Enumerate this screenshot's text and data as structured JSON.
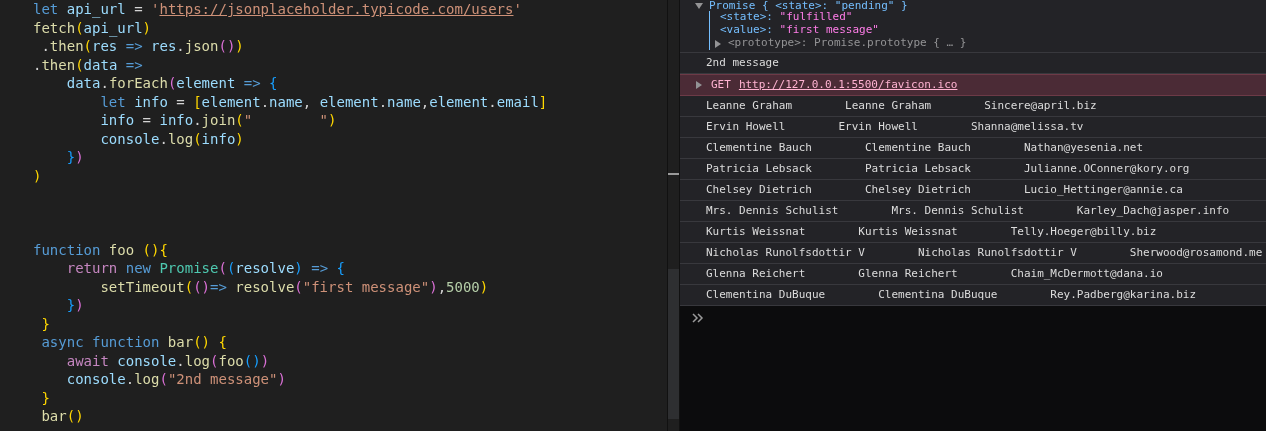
{
  "editor": {
    "blocks": [
      {
        "lines": [
          [
            {
              "kind": "kw",
              "t": "let"
            },
            {
              "kind": "var",
              "t": " api_url"
            },
            {
              "kind": "p",
              "t": " = "
            },
            {
              "kind": "str",
              "t": "'"
            },
            {
              "kind": "link",
              "t": "https://jsonplaceholder.typicode.com/users"
            },
            {
              "kind": "str",
              "t": "'"
            }
          ],
          [
            {
              "kind": "fn",
              "t": "fetch"
            },
            {
              "kind": "b1",
              "t": "("
            },
            {
              "kind": "var",
              "t": "api_url"
            },
            {
              "kind": "b1",
              "t": ")"
            }
          ],
          [
            {
              "kind": "p",
              "t": " ."
            },
            {
              "kind": "fn",
              "t": "then"
            },
            {
              "kind": "b1",
              "t": "("
            },
            {
              "kind": "var",
              "t": "res"
            },
            {
              "kind": "kw",
              "t": " =>"
            },
            {
              "kind": "var",
              "t": " res"
            },
            {
              "kind": "p",
              "t": "."
            },
            {
              "kind": "fn",
              "t": "json"
            },
            {
              "kind": "b2",
              "t": "()"
            },
            {
              "kind": "b1",
              "t": ")"
            }
          ],
          [
            {
              "kind": "p",
              "t": "."
            },
            {
              "kind": "fn",
              "t": "then"
            },
            {
              "kind": "b1",
              "t": "("
            },
            {
              "kind": "var",
              "t": "data"
            },
            {
              "kind": "kw",
              "t": " =>"
            }
          ],
          [
            {
              "kind": "var",
              "t": "    data"
            },
            {
              "kind": "p",
              "t": "."
            },
            {
              "kind": "fn",
              "t": "forEach"
            },
            {
              "kind": "b2",
              "t": "("
            },
            {
              "kind": "var",
              "t": "element"
            },
            {
              "kind": "kw",
              "t": " =>"
            },
            {
              "kind": "b3",
              "t": " {"
            }
          ],
          [
            {
              "kind": "kw",
              "t": "        let"
            },
            {
              "kind": "var",
              "t": " info"
            },
            {
              "kind": "p",
              "t": " = "
            },
            {
              "kind": "b1",
              "t": "["
            },
            {
              "kind": "var",
              "t": "element"
            },
            {
              "kind": "p",
              "t": "."
            },
            {
              "kind": "var",
              "t": "name"
            },
            {
              "kind": "p",
              "t": ", "
            },
            {
              "kind": "var",
              "t": "element"
            },
            {
              "kind": "p",
              "t": "."
            },
            {
              "kind": "var",
              "t": "name"
            },
            {
              "kind": "p",
              "t": ","
            },
            {
              "kind": "var",
              "t": "element"
            },
            {
              "kind": "p",
              "t": "."
            },
            {
              "kind": "var",
              "t": "email"
            },
            {
              "kind": "b1",
              "t": "]"
            }
          ],
          [
            {
              "kind": "var",
              "t": "        info"
            },
            {
              "kind": "p",
              "t": " = "
            },
            {
              "kind": "var",
              "t": "info"
            },
            {
              "kind": "p",
              "t": "."
            },
            {
              "kind": "fn",
              "t": "join"
            },
            {
              "kind": "b1",
              "t": "("
            },
            {
              "kind": "str",
              "t": "\"        \""
            },
            {
              "kind": "b1",
              "t": ")"
            }
          ],
          [
            {
              "kind": "var",
              "t": "        console"
            },
            {
              "kind": "p",
              "t": "."
            },
            {
              "kind": "fn",
              "t": "log"
            },
            {
              "kind": "b1",
              "t": "("
            },
            {
              "kind": "var",
              "t": "info"
            },
            {
              "kind": "b1",
              "t": ")"
            }
          ],
          [
            {
              "kind": "b3",
              "t": "    }"
            },
            {
              "kind": "b2",
              "t": ")"
            }
          ],
          [
            {
              "kind": "b1",
              "t": ")"
            }
          ]
        ]
      },
      {
        "lines": [
          [
            {
              "kind": "kw",
              "t": "function"
            },
            {
              "kind": "fn",
              "t": " foo"
            },
            {
              "kind": "b1",
              "t": " (){"
            }
          ],
          [
            {
              "kind": "ctrl",
              "t": "    return"
            },
            {
              "kind": "kw",
              "t": " new"
            },
            {
              "kind": "cls",
              "t": " Promise"
            },
            {
              "kind": "b2",
              "t": "("
            },
            {
              "kind": "b3",
              "t": "("
            },
            {
              "kind": "var",
              "t": "resolve"
            },
            {
              "kind": "b3",
              "t": ")"
            },
            {
              "kind": "kw",
              "t": " =>"
            },
            {
              "kind": "b3",
              "t": " {"
            }
          ],
          [
            {
              "kind": "fn",
              "t": "        setTimeout"
            },
            {
              "kind": "b1",
              "t": "("
            },
            {
              "kind": "b2",
              "t": "()"
            },
            {
              "kind": "kw",
              "t": "=>"
            },
            {
              "kind": "fn",
              "t": " resolve"
            },
            {
              "kind": "b2",
              "t": "("
            },
            {
              "kind": "str",
              "t": "\"first message\""
            },
            {
              "kind": "b2",
              "t": ")"
            },
            {
              "kind": "p",
              "t": ","
            },
            {
              "kind": "num",
              "t": "5000"
            },
            {
              "kind": "b1",
              "t": ")"
            }
          ],
          [
            {
              "kind": "b3",
              "t": "    }"
            },
            {
              "kind": "b2",
              "t": ")"
            }
          ],
          [
            {
              "kind": "b1",
              "t": " }"
            }
          ],
          [
            {
              "kind": "kw",
              "t": " async"
            },
            {
              "kind": "kw",
              "t": " function"
            },
            {
              "kind": "fn",
              "t": " bar"
            },
            {
              "kind": "b1",
              "t": "()"
            },
            {
              "kind": "b1",
              "t": " {"
            }
          ],
          [
            {
              "kind": "ctrl",
              "t": "    await"
            },
            {
              "kind": "var",
              "t": " console"
            },
            {
              "kind": "p",
              "t": "."
            },
            {
              "kind": "fn",
              "t": "log"
            },
            {
              "kind": "b2",
              "t": "("
            },
            {
              "kind": "fn",
              "t": "foo"
            },
            {
              "kind": "b3",
              "t": "()"
            },
            {
              "kind": "b2",
              "t": ")"
            }
          ],
          [
            {
              "kind": "var",
              "t": "    console"
            },
            {
              "kind": "p",
              "t": "."
            },
            {
              "kind": "fn",
              "t": "log"
            },
            {
              "kind": "b2",
              "t": "("
            },
            {
              "kind": "str",
              "t": "\"2nd message\""
            },
            {
              "kind": "b2",
              "t": ")"
            }
          ],
          [
            {
              "kind": "b1",
              "t": " }"
            }
          ],
          [
            {
              "kind": "fn",
              "t": " bar"
            },
            {
              "kind": "b1",
              "t": "()"
            }
          ]
        ]
      }
    ]
  },
  "console": {
    "promise": {
      "label": "Promise { <state>: \"pending\" }",
      "expanded": true,
      "props": [
        {
          "key": "<state>:",
          "value": "\"fulfilled\""
        },
        {
          "key": "<value>:",
          "value": "\"first message\""
        }
      ],
      "prototype": {
        "key": "<prototype>:",
        "value": "Promise.prototype { … }",
        "expanded": false
      }
    },
    "messages": [
      {
        "kind": "log",
        "text": "2nd message"
      },
      {
        "kind": "error",
        "method": "GET",
        "url": "http://127.0.0.1:5500/favicon.ico",
        "expanded": false
      },
      {
        "kind": "log",
        "text": "Leanne Graham        Leanne Graham        Sincere@april.biz"
      },
      {
        "kind": "log",
        "text": "Ervin Howell        Ervin Howell        Shanna@melissa.tv"
      },
      {
        "kind": "log",
        "text": "Clementine Bauch        Clementine Bauch        Nathan@yesenia.net"
      },
      {
        "kind": "log",
        "text": "Patricia Lebsack        Patricia Lebsack        Julianne.OConner@kory.org"
      },
      {
        "kind": "log",
        "text": "Chelsey Dietrich        Chelsey Dietrich        Lucio_Hettinger@annie.ca"
      },
      {
        "kind": "log",
        "text": "Mrs. Dennis Schulist        Mrs. Dennis Schulist        Karley_Dach@jasper.info"
      },
      {
        "kind": "log",
        "text": "Kurtis Weissnat        Kurtis Weissnat        Telly.Hoeger@billy.biz"
      },
      {
        "kind": "log",
        "text": "Nicholas Runolfsdottir V        Nicholas Runolfsdottir V        Sherwood@rosamond.me"
      },
      {
        "kind": "log",
        "text": "Glenna Reichert        Glenna Reichert        Chaim_McDermott@dana.io"
      },
      {
        "kind": "log",
        "text": "Clementina DuBuque        Clementina DuBuque        Rey.Padberg@karina.biz"
      }
    ]
  }
}
